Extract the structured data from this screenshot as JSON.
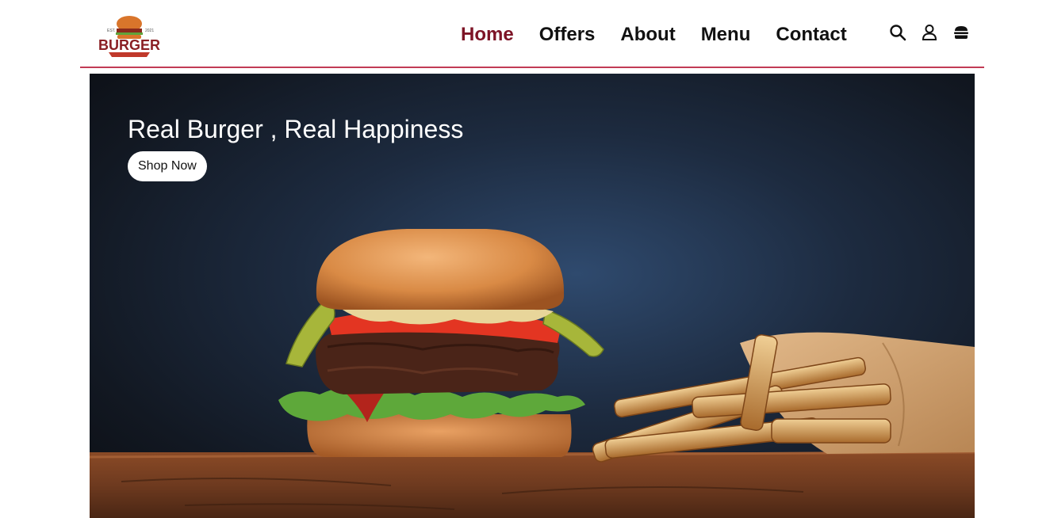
{
  "brand": {
    "logo_text": "BURGER",
    "logo_est": "EST.",
    "logo_year": "2021"
  },
  "nav": {
    "items": [
      {
        "label": "Home",
        "active": true
      },
      {
        "label": "Offers",
        "active": false
      },
      {
        "label": "About",
        "active": false
      },
      {
        "label": "Menu",
        "active": false
      },
      {
        "label": "Contact",
        "active": false
      }
    ]
  },
  "header_icons": [
    "search-icon",
    "user-icon",
    "burger-cart-icon"
  ],
  "hero": {
    "title": "Real Burger , Real Happiness",
    "button_label": "Shop Now",
    "image": "burger-and-fries-photo"
  },
  "colors": {
    "accent": "#7d1426",
    "divider": "#c23b55",
    "hero_bg": "#1d2b40"
  }
}
